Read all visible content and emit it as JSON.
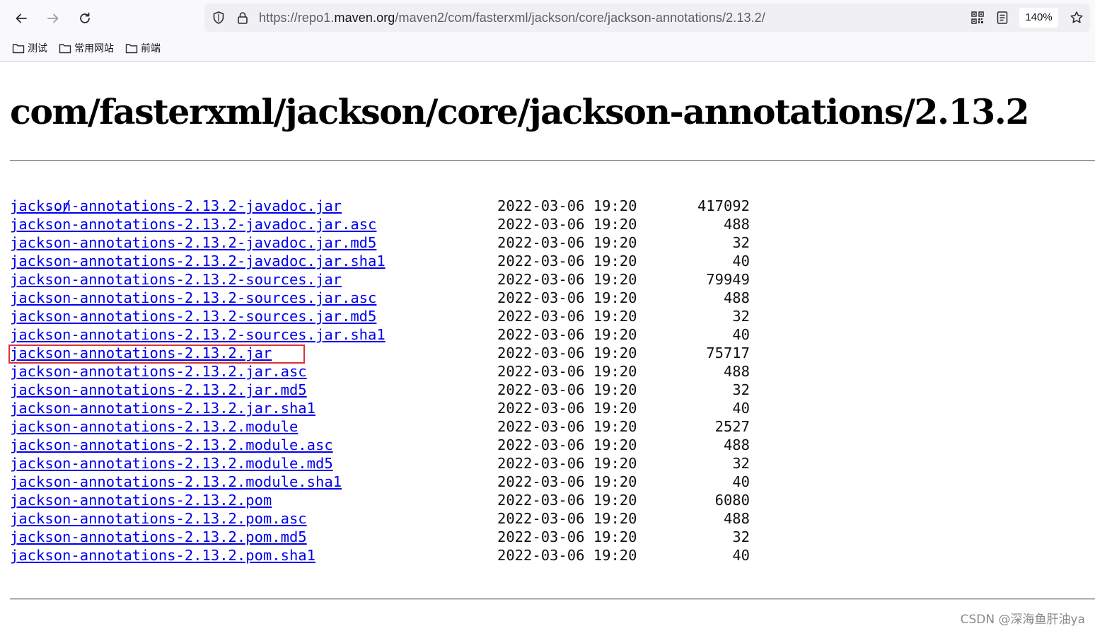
{
  "browser": {
    "url_scheme": "https://repo1.",
    "url_domain": "maven.org",
    "url_path": "/maven2/com/fasterxml/jackson/core/jackson-annotations/2.13.2/",
    "zoom": "140%",
    "bookmarks": [
      {
        "label": "测试",
        "icon": "folder-icon"
      },
      {
        "label": "常用网站",
        "icon": "folder-icon"
      },
      {
        "label": "前端",
        "icon": "folder-icon"
      }
    ]
  },
  "page": {
    "title": "com/fasterxml/jackson/core/jackson-annotations/2.13.2",
    "parent_link": "../",
    "files": [
      {
        "name": "jackson-annotations-2.13.2-javadoc.jar",
        "date": "2022-03-06 19:20",
        "size": "417092"
      },
      {
        "name": "jackson-annotations-2.13.2-javadoc.jar.asc",
        "date": "2022-03-06 19:20",
        "size": "488"
      },
      {
        "name": "jackson-annotations-2.13.2-javadoc.jar.md5",
        "date": "2022-03-06 19:20",
        "size": "32"
      },
      {
        "name": "jackson-annotations-2.13.2-javadoc.jar.sha1",
        "date": "2022-03-06 19:20",
        "size": "40"
      },
      {
        "name": "jackson-annotations-2.13.2-sources.jar",
        "date": "2022-03-06 19:20",
        "size": "79949"
      },
      {
        "name": "jackson-annotations-2.13.2-sources.jar.asc",
        "date": "2022-03-06 19:20",
        "size": "488"
      },
      {
        "name": "jackson-annotations-2.13.2-sources.jar.md5",
        "date": "2022-03-06 19:20",
        "size": "32"
      },
      {
        "name": "jackson-annotations-2.13.2-sources.jar.sha1",
        "date": "2022-03-06 19:20",
        "size": "40"
      },
      {
        "name": "jackson-annotations-2.13.2.jar",
        "date": "2022-03-06 19:20",
        "size": "75717",
        "highlighted": true
      },
      {
        "name": "jackson-annotations-2.13.2.jar.asc",
        "date": "2022-03-06 19:20",
        "size": "488"
      },
      {
        "name": "jackson-annotations-2.13.2.jar.md5",
        "date": "2022-03-06 19:20",
        "size": "32"
      },
      {
        "name": "jackson-annotations-2.13.2.jar.sha1",
        "date": "2022-03-06 19:20",
        "size": "40"
      },
      {
        "name": "jackson-annotations-2.13.2.module",
        "date": "2022-03-06 19:20",
        "size": "2527"
      },
      {
        "name": "jackson-annotations-2.13.2.module.asc",
        "date": "2022-03-06 19:20",
        "size": "488"
      },
      {
        "name": "jackson-annotations-2.13.2.module.md5",
        "date": "2022-03-06 19:20",
        "size": "32"
      },
      {
        "name": "jackson-annotations-2.13.2.module.sha1",
        "date": "2022-03-06 19:20",
        "size": "40"
      },
      {
        "name": "jackson-annotations-2.13.2.pom",
        "date": "2022-03-06 19:20",
        "size": "6080"
      },
      {
        "name": "jackson-annotations-2.13.2.pom.asc",
        "date": "2022-03-06 19:20",
        "size": "488"
      },
      {
        "name": "jackson-annotations-2.13.2.pom.md5",
        "date": "2022-03-06 19:20",
        "size": "32"
      },
      {
        "name": "jackson-annotations-2.13.2.pom.sha1",
        "date": "2022-03-06 19:20",
        "size": "40"
      }
    ]
  },
  "watermark": "CSDN @深海鱼肝油ya",
  "colors": {
    "link": "#0000ee",
    "highlight_border": "#e03131"
  }
}
